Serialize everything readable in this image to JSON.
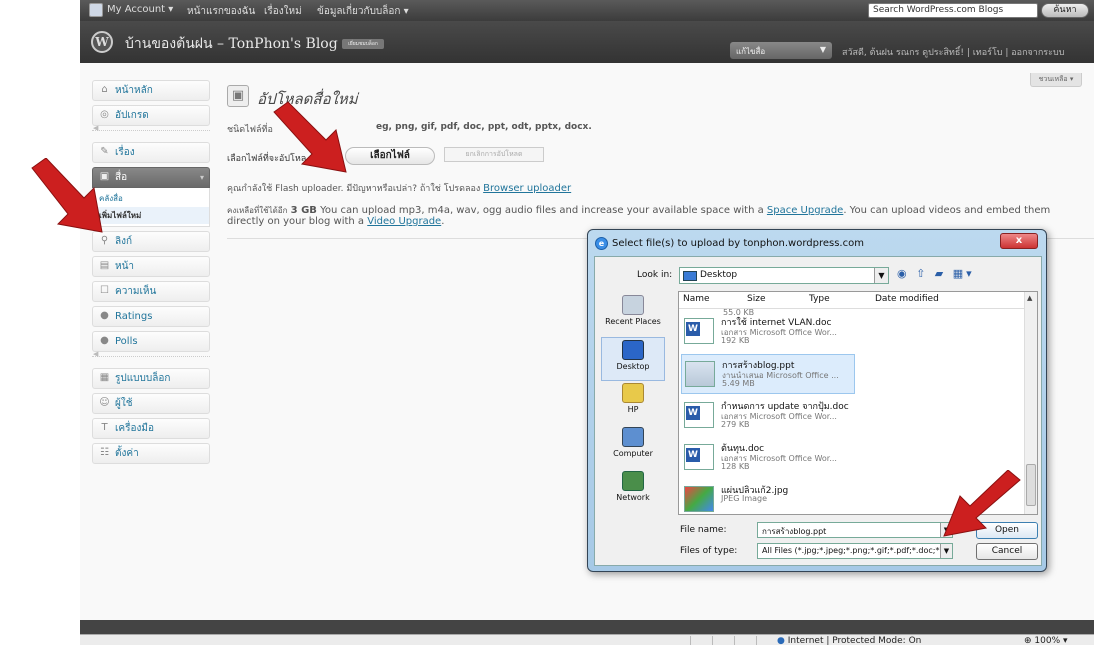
{
  "adminbar": {
    "account": "My Account ▾",
    "nav": [
      "หน้าแรกของฉัน",
      "เรื่องใหม่",
      "ข้อมูลเกี่ยวกับบล็อก ▾"
    ],
    "search_placeholder": "Search WordPress.com Blogs",
    "search_button": "ค้นหา"
  },
  "header": {
    "site_title": "บ้านของต้นฝน – TonPhon's Blog",
    "site_badge": "เยี่ยมชมบล็อก",
    "favorites_select": "แก้ไขสื่อ",
    "howdy": "สวัสดี, ต้นฝน รณกร  ดูประสิทธิ์! | เทอร์โบ | ออกจากระบบ"
  },
  "sidebar": {
    "top_items": [
      {
        "label": "หน้าหลัก",
        "icon": "⌂"
      },
      {
        "label": "อัปเกรด",
        "icon": "◎"
      }
    ],
    "posts": {
      "label": "เรื่อง",
      "icon": "✎"
    },
    "media": {
      "label": "สื่อ",
      "icon": "▣",
      "toggle": "▾",
      "subitems": [
        "คลังสื่อ",
        "เพิ่มไฟล์ใหม่"
      ]
    },
    "mid_items": [
      {
        "label": "ลิงก์",
        "icon": "⚲"
      },
      {
        "label": "หน้า",
        "icon": "▤"
      },
      {
        "label": "ความเห็น",
        "icon": "☐"
      },
      {
        "label": "Ratings",
        "icon": "●"
      },
      {
        "label": "Polls",
        "icon": "●"
      }
    ],
    "bottom_items": [
      {
        "label": "รูปแบบบล็อก",
        "icon": "▦"
      },
      {
        "label": "ผู้ใช้",
        "icon": "☺"
      },
      {
        "label": "เครื่องมือ",
        "icon": "T"
      },
      {
        "label": "ตั้งค่า",
        "icon": "☷"
      }
    ]
  },
  "main": {
    "screen_options": "ชวนเหลือ ▾",
    "title": "อัปโหลดสื่อใหม่",
    "file_types_label": "ชนิดไฟล์ที่อ",
    "file_types_value": "eg, png, gif, pdf, doc, ppt, odt, pptx, docx.",
    "select_label": "เลือกไฟล์ที่จะอัปโหล",
    "select_button": "เลือกไฟล์",
    "cancel_upload": "ยกเลิกการอัปโหลด",
    "uploader_text": "คุณกำลังใช้  Flash uploader. มีปัญหาหรือเปล่า? ถ้าใช่  โปรดลอง",
    "browser_uploader": "Browser uploader",
    "space_prefix": "คงเหลือที่ใช้ได้อีก",
    "space_amount": "3 GB",
    "space_text": "You can upload mp3, m4a, wav, ogg audio files and increase your available space with a",
    "space_upgrade": "Space Upgrade",
    "space_text2": ". You can upload videos and embed them",
    "space_text3": "directly on your blog with a",
    "video_upgrade": "Video Upgrade",
    "space_text4": "."
  },
  "statusbar": {
    "zone": "Internet | Protected Mode: On",
    "zoom": "100%"
  },
  "dialog": {
    "title": "Select file(s) to upload by tonphon.wordpress.com",
    "close": "x",
    "lookin_label": "Look in:",
    "lookin_value": "Desktop",
    "toolbar_icons": "◉ ⇧ ▰ ▦▾",
    "places": [
      "Recent Places",
      "Desktop",
      "HP",
      "Computer",
      "Network"
    ],
    "columns": [
      "Name",
      "Size",
      "Type",
      "Date modified"
    ],
    "files": [
      {
        "name": "การใช้ internet VLAN.doc",
        "type": "เอกสาร Microsoft Office Wor...",
        "size": "192 KB",
        "kind": "doc",
        "selected": false
      },
      {
        "name": "การสร้างblog.ppt",
        "type": "งานนำเสนอ Microsoft Office ...",
        "size": "5.49 MB",
        "kind": "ppt",
        "selected": true
      },
      {
        "name": "กำหนดการ update จากปุ้ม.doc",
        "type": "เอกสาร Microsoft Office Wor...",
        "size": "279 KB",
        "kind": "doc",
        "selected": false
      },
      {
        "name": "ต้นทุน.doc",
        "type": "เอกสาร Microsoft Office Wor...",
        "size": "128 KB",
        "kind": "doc",
        "selected": false
      },
      {
        "name": "แผ่นปลิวแก้2.jpg",
        "type": "JPEG Image",
        "size": "",
        "kind": "jpg",
        "selected": false
      }
    ],
    "partial_size": "55.0 KB",
    "file_name_label": "File name:",
    "file_name_value": "การสร้างblog.ppt",
    "file_type_label": "Files of type:",
    "file_type_value": "All Files (*.jpg;*.jpeg;*.png;*.gif;*.pdf;*.doc;*.ppt;",
    "open_button": "Open",
    "cancel_button": "Cancel"
  },
  "colors": {
    "link": "#21759b",
    "arrow": "#cc1f1f",
    "header_bg": "#3c3c3c"
  }
}
